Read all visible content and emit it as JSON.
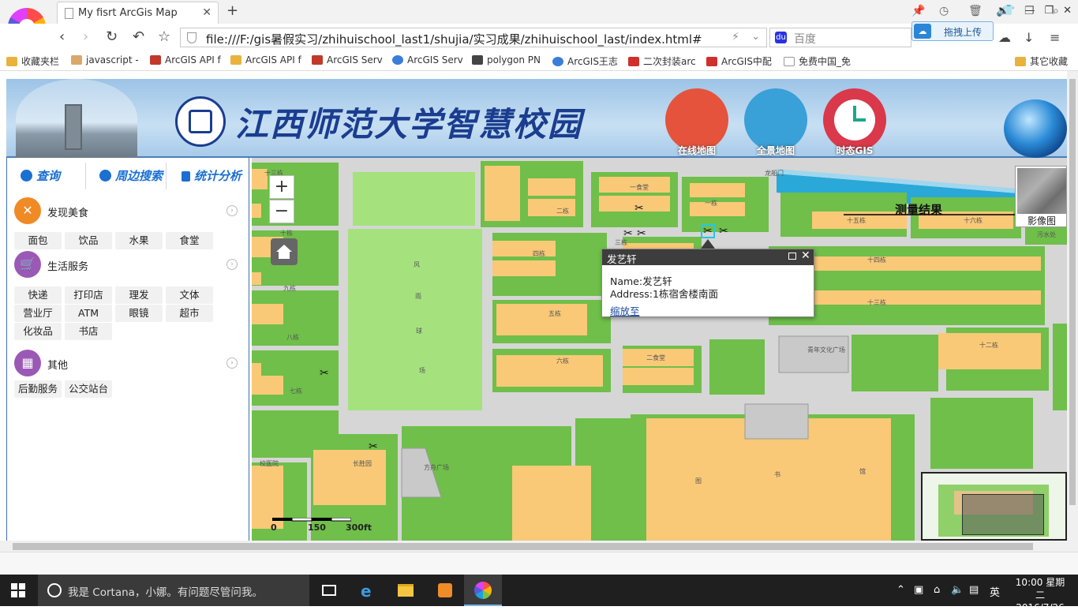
{
  "browser": {
    "tab_title": "My fisrt ArcGis Map",
    "url": "file:///F:/gis暑假实习/zhihuischool_last1/shujia/实习成果/zhihuischool_last/index.html#",
    "search_placeholder": "百度",
    "upload_label": "拖拽上传",
    "bookmarks": [
      "收藏夹栏",
      "javascript -",
      "ArcGIS API f",
      "ArcGIS API f",
      "ArcGIS Serv",
      "ArcGIS Serv",
      "polygon PN",
      "ArcGIS王志",
      "二次封装arc",
      "ArcGIS中配",
      "免费中国_免",
      "其它收藏"
    ]
  },
  "header": {
    "title": "江西师范大学智慧校园",
    "buttons": [
      "在线地图",
      "全景地图",
      "时态GIS"
    ]
  },
  "sidebar": {
    "tabs": [
      "查询",
      "周边搜索",
      "统计分析"
    ],
    "categories": [
      {
        "name": "发现美食",
        "icon": "utensils-icon",
        "items": [
          "面包",
          "饮品",
          "水果",
          "食堂"
        ]
      },
      {
        "name": "生活服务",
        "icon": "cart-icon",
        "items": [
          "快递",
          "打印店",
          "理发",
          "文体",
          "营业厅",
          "ATM",
          "眼镜",
          "超市",
          "化妆品",
          "书店"
        ]
      },
      {
        "name": "其他",
        "icon": "building-icon",
        "items": [
          "后勤服务",
          "公交站台"
        ]
      }
    ]
  },
  "map": {
    "zoom_in": "+",
    "zoom_out": "−",
    "basemap_label": "影像图",
    "measure_title": "测量结果",
    "scale_labels": [
      "0",
      "150",
      "300ft"
    ],
    "popup": {
      "title": "发艺轩",
      "name_line": "Name:发艺轩",
      "address_line": "Address:1栋宿舍楼南面",
      "zoom_link": "缩放至"
    },
    "labels": {
      "road_top": "龙船门",
      "dorm1": "一食堂",
      "dorm2": "二栋",
      "dorm3": "三栋",
      "dorm4": "四栋",
      "dorm5": "五栋",
      "dorm6": "六栋",
      "canteen2": "二食堂",
      "youth_square": "青年文化广场",
      "b12": "十二栋",
      "b13": "十三栋",
      "b14": "十四栋",
      "b15": "十五栋",
      "b16": "十六栋",
      "wuyin": "污水处",
      "hospital": "校医院",
      "changsheng": "长胜园",
      "square": "方舟广场",
      "library_a": "图",
      "library_b": "书",
      "library_c": "馆",
      "sports": [
        "风",
        "雨",
        "球",
        "场"
      ],
      "dorm_left": [
        "十三栋",
        "十栋",
        "九栋",
        "八栋",
        "七栋"
      ],
      "cafe": "一栋"
    }
  },
  "statusbar": {
    "cortana": "我是 Cortana，小娜。有问题尽管问我。",
    "time": "10:00 星期二",
    "date": "2016/7/26",
    "ime": "英"
  }
}
